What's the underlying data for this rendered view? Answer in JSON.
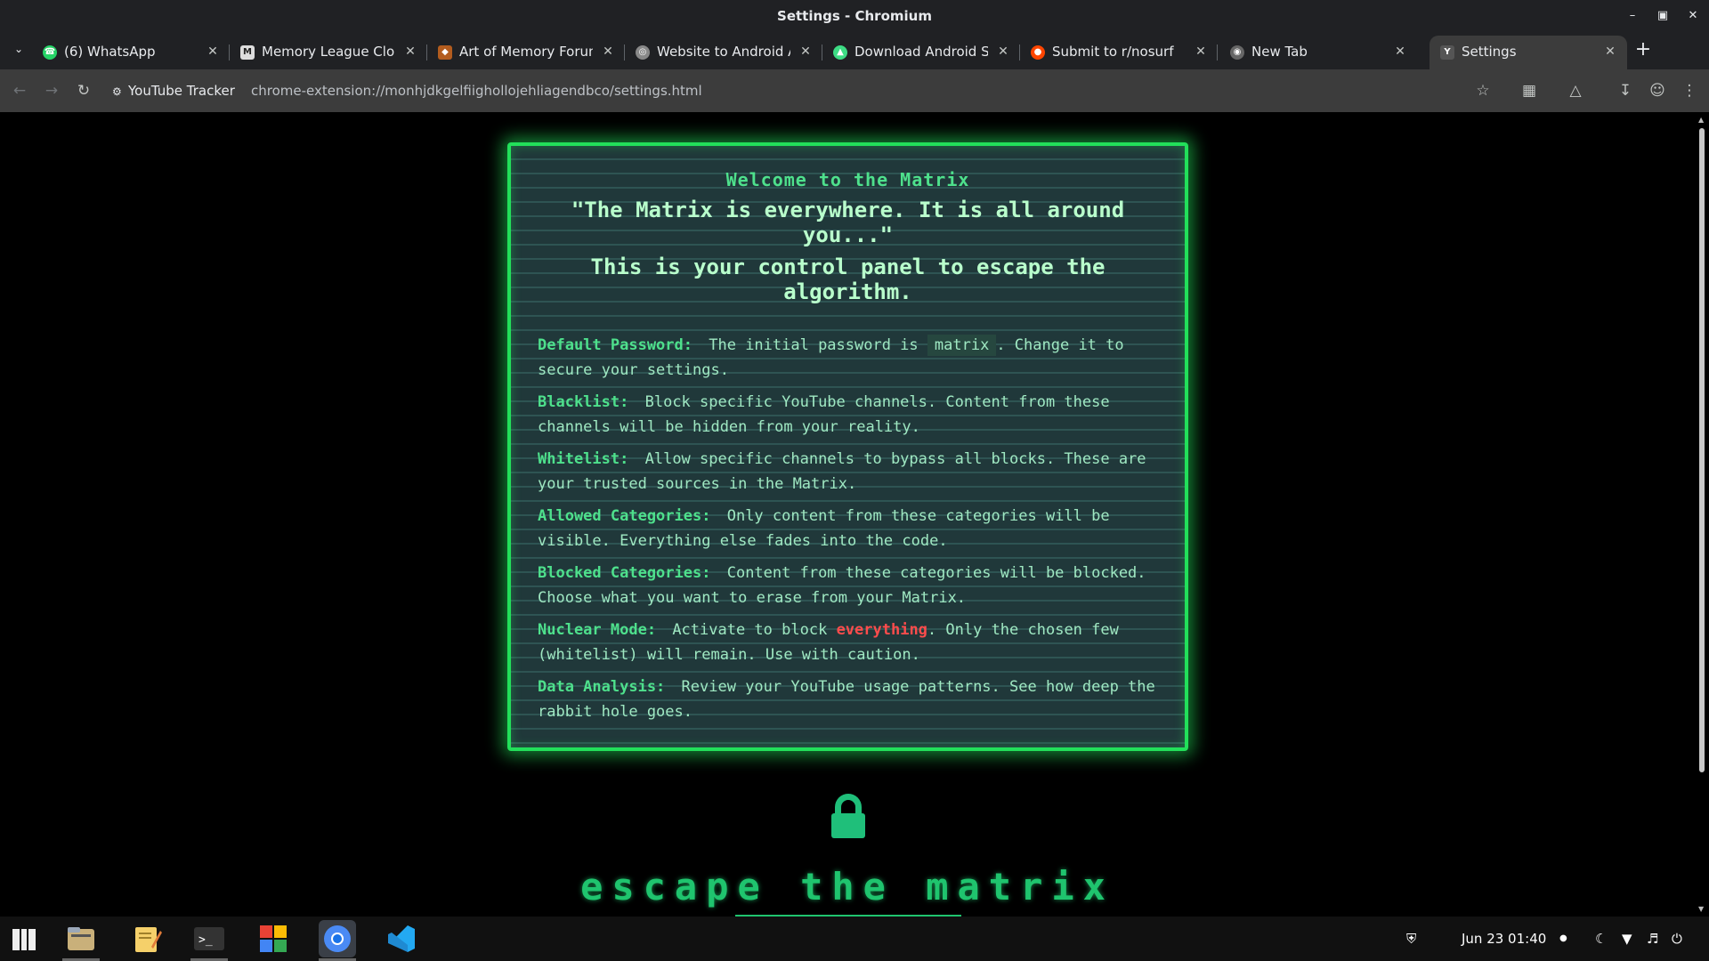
{
  "window": {
    "title": "Settings - Chromium"
  },
  "tabs": [
    {
      "label": "(6) WhatsApp",
      "icon": "whatsapp-icon"
    },
    {
      "label": "Memory League Clon",
      "icon": "memory-league-icon"
    },
    {
      "label": "Art of Memory Forum",
      "icon": "art-of-memory-icon"
    },
    {
      "label": "Website to Android Ap",
      "icon": "globe-icon"
    },
    {
      "label": "Download Android St",
      "icon": "android-icon"
    },
    {
      "label": "Submit to r/nosurf",
      "icon": "reddit-icon"
    },
    {
      "label": "New Tab",
      "icon": "chromium-icon"
    },
    {
      "label": "Settings",
      "icon": "extension-page-icon"
    }
  ],
  "toolbar": {
    "extension_chip": "YouTube Tracker",
    "url": "chrome-extension://monhjdkgelfiighollojehliagendbco/settings.html"
  },
  "panel": {
    "title": "Welcome to the Matrix",
    "quote": "\"The Matrix is everywhere. It is all around you...\"",
    "intro": "This is your control panel to escape the algorithm.",
    "items": [
      {
        "key": "Default Password:",
        "pre": "The initial password is",
        "code": "matrix",
        "post": ". Change it to secure your settings."
      },
      {
        "key": "Blacklist:",
        "text": "Block specific YouTube channels. Content from these channels will be hidden from your reality."
      },
      {
        "key": "Whitelist:",
        "text": "Allow specific channels to bypass all blocks. These are your trusted sources in the Matrix."
      },
      {
        "key": "Allowed Categories:",
        "text": "Only content from these categories will be visible. Everything else fades into the code."
      },
      {
        "key": "Blocked Categories:",
        "text": "Content from these categories will be blocked. Choose what you want to erase from your Matrix."
      },
      {
        "key": "Nuclear Mode:",
        "pre": "Activate to block",
        "danger": "everything",
        "post": ". Only the chosen few (whitelist) will remain. Use with caution."
      },
      {
        "key": "Data Analysis:",
        "text": "Review your YouTube usage patterns. See how deep the rabbit hole goes."
      }
    ]
  },
  "footer": {
    "escape_text": "escape the matrix"
  },
  "taskbar": {
    "apps": [
      "app-grid-icon",
      "files-icon",
      "text-editor-icon",
      "terminal-icon",
      "software-store-icon",
      "chromium-icon",
      "vscode-icon"
    ],
    "datetime": "Jun 23  01:40"
  },
  "colors": {
    "matrix_green": "#22e05a",
    "text_green": "#9fe8c2",
    "danger_red": "#ff4c4c"
  }
}
